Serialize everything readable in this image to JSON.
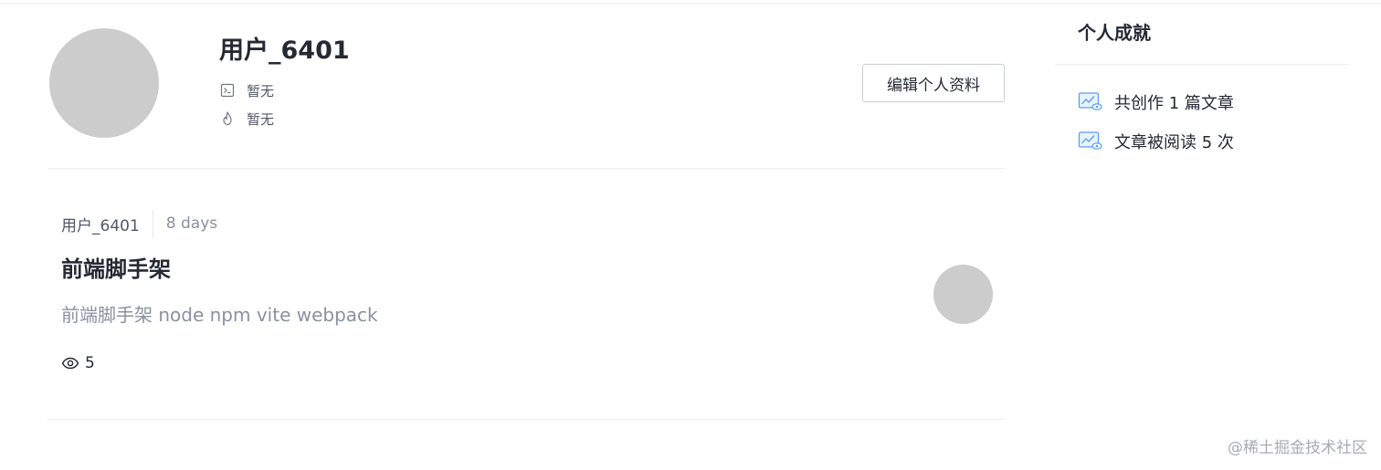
{
  "profile": {
    "username": "用户_6401",
    "job_title": "暂无",
    "description": "暂无",
    "edit_button_label": "编辑个人资料"
  },
  "article": {
    "author": "用户_6401",
    "date": "8 days",
    "title": "前端脚手架",
    "summary": "前端脚手架 node npm vite webpack",
    "views": "5"
  },
  "achievements": {
    "title": "个人成就",
    "items": [
      {
        "label": "共创作 1 篇文章",
        "icon": "article-stats-icon"
      },
      {
        "label": "文章被阅读 5 次",
        "icon": "read-stats-icon"
      }
    ]
  },
  "watermark": "@稀土掘金技术社区",
  "colors": {
    "avatar_placeholder": "#cccccc",
    "stat_icon_blue": "#1e80ff",
    "muted_text": "#8a919f"
  }
}
